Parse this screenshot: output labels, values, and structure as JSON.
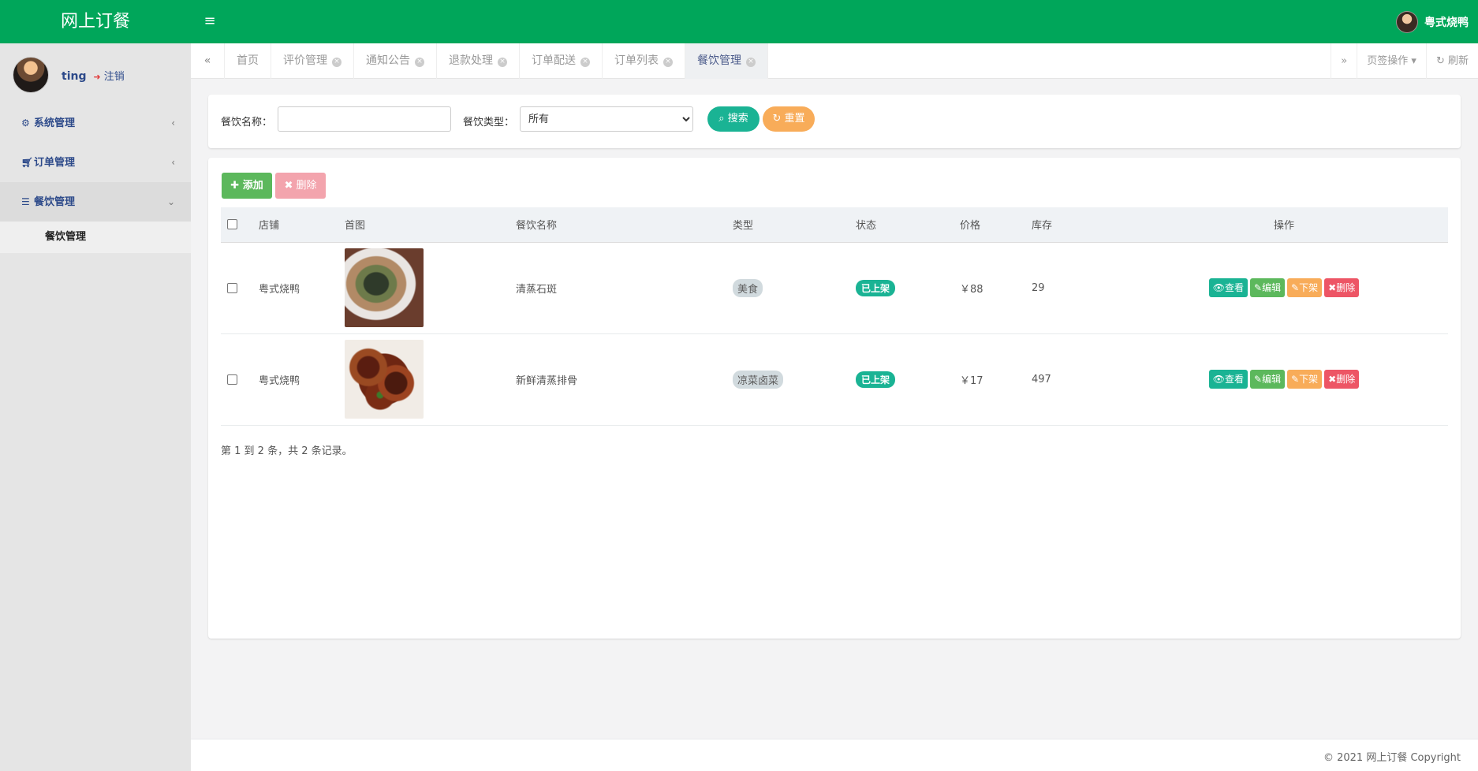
{
  "app": {
    "brand": "网上订餐",
    "user_top": "粤式烧鸭"
  },
  "sidebar": {
    "username": "ting",
    "logout": "注销",
    "items": [
      {
        "label": "系统管理",
        "icon": "gear-icon"
      },
      {
        "label": "订单管理",
        "icon": "cart-icon"
      },
      {
        "label": "餐饮管理",
        "icon": "list-icon"
      }
    ],
    "sub_item": "餐饮管理"
  },
  "tabs": {
    "items": [
      {
        "label": "首页",
        "closable": false
      },
      {
        "label": "评价管理",
        "closable": true
      },
      {
        "label": "通知公告",
        "closable": true
      },
      {
        "label": "退款处理",
        "closable": true
      },
      {
        "label": "订单配送",
        "closable": true
      },
      {
        "label": "订单列表",
        "closable": true
      },
      {
        "label": "餐饮管理",
        "closable": true,
        "active": true
      }
    ],
    "tab_ops": "页签操作",
    "refresh": "刷新"
  },
  "search": {
    "name_label": "餐饮名称：",
    "name_value": "",
    "type_label": "餐饮类型：",
    "type_value": "所有",
    "search_btn": "搜索",
    "reset_btn": "重置"
  },
  "toolbar": {
    "add": "添加",
    "delete": "删除"
  },
  "table": {
    "headers": [
      "店铺",
      "首图",
      "餐饮名称",
      "类型",
      "状态",
      "价格",
      "库存",
      "操作"
    ],
    "rows": [
      {
        "shop": "粤式烧鸭",
        "name": "清蒸石斑",
        "type": "美食",
        "status": "已上架",
        "price": "￥88",
        "stock": "29"
      },
      {
        "shop": "粤式烧鸭",
        "name": "新鲜清蒸排骨",
        "type": "凉菜卤菜",
        "status": "已上架",
        "price": "￥17",
        "stock": "497"
      }
    ],
    "ops": {
      "view": "查看",
      "edit": "编辑",
      "off": "下架",
      "del": "删除"
    }
  },
  "pager": "第 1 到 2 条，共 2 条记录。",
  "footer": "© 2021 网上订餐 Copyright",
  "colors": {
    "header": "#00a65a",
    "teal": "#1ab394",
    "green": "#5cb85c",
    "orange": "#f8ac59",
    "red": "#ed5565"
  }
}
